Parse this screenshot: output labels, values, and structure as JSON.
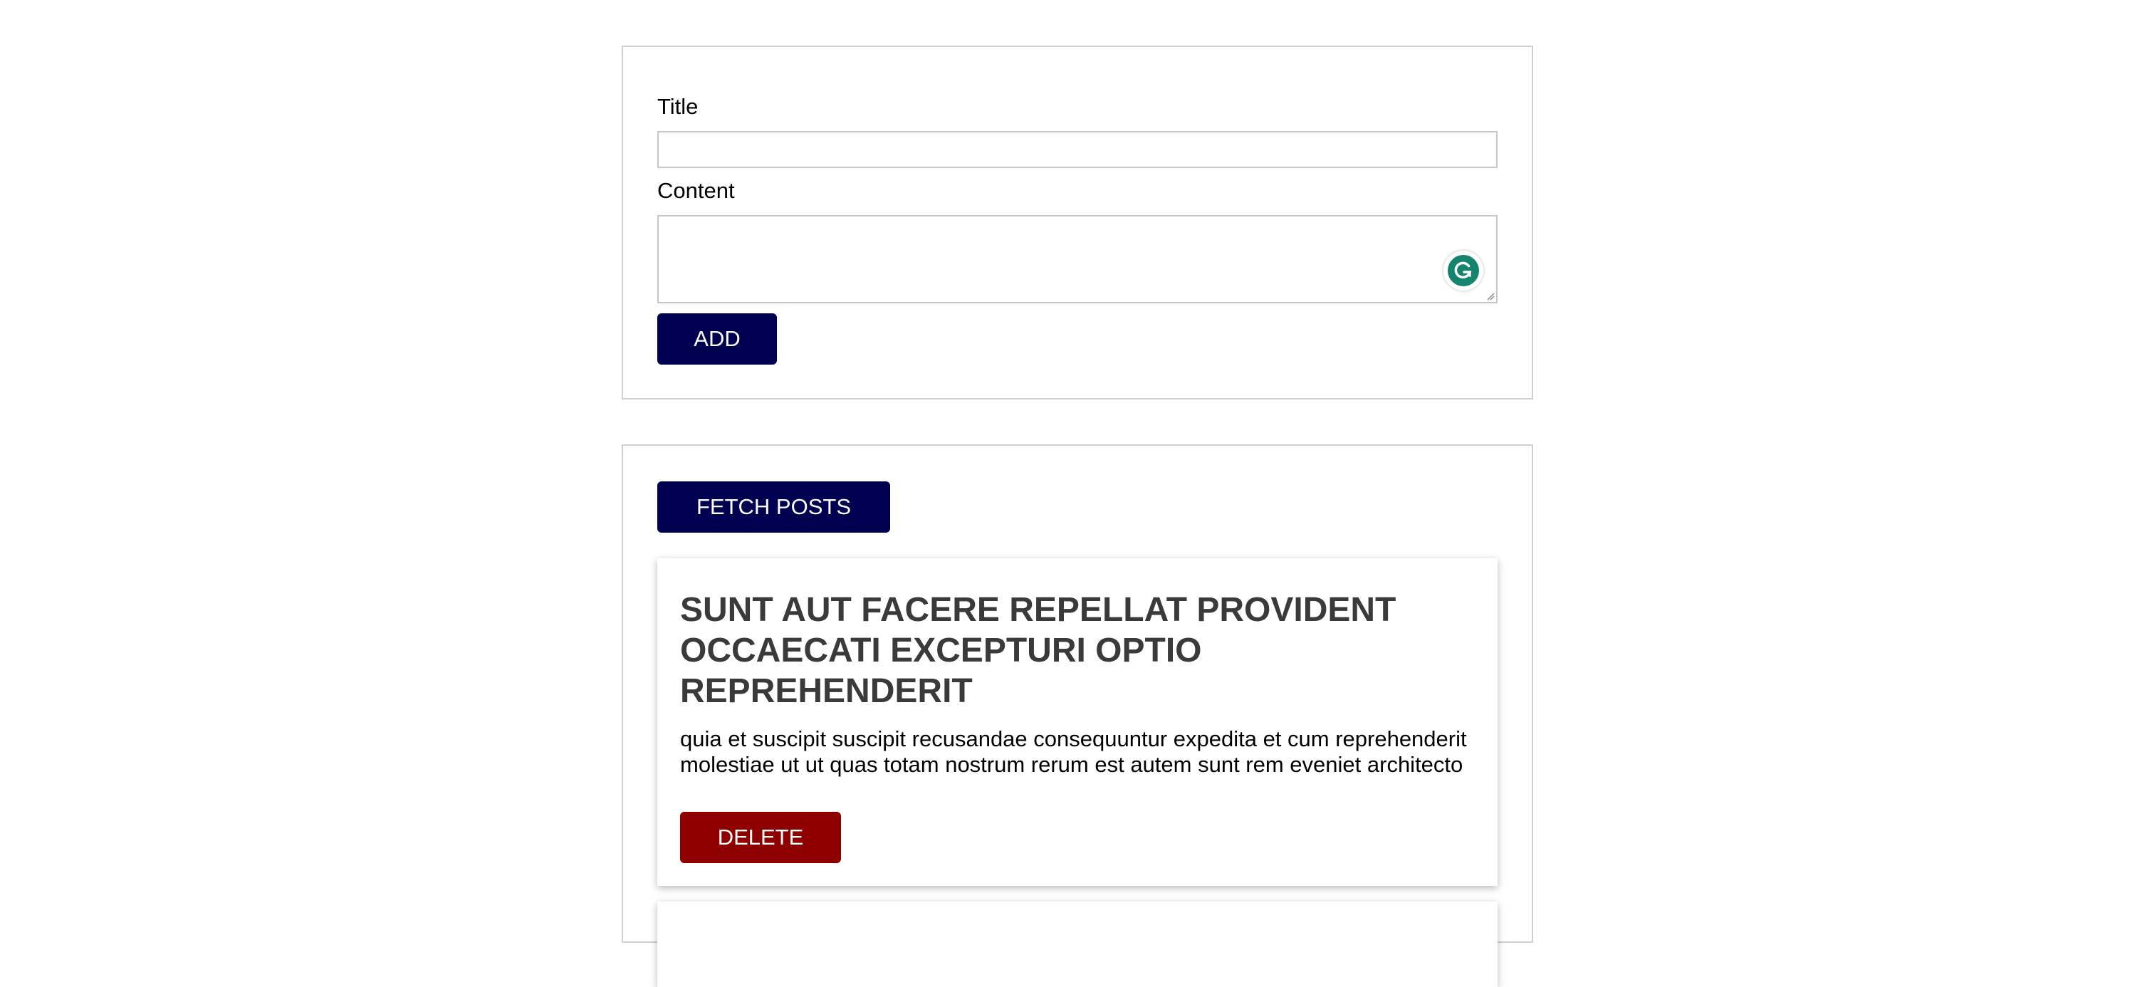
{
  "form": {
    "title_label": "Title",
    "title_value": "",
    "content_label": "Content",
    "content_value": "",
    "add_button": "ADD"
  },
  "posts_panel": {
    "fetch_button": "FETCH POSTS",
    "posts": [
      {
        "title": "sunt aut facere repellat provident occaecati excepturi optio reprehenderit",
        "body": "quia et suscipit suscipit recusandae consequuntur expedita et cum reprehenderit molestiae ut ut quas totam nostrum rerum est autem sunt rem eveniet architecto",
        "delete_button": "DELETE"
      }
    ]
  },
  "colors": {
    "primary_button": "#000050",
    "delete_button": "#8e0000",
    "grammarly": "#15846f"
  },
  "icons": {
    "grammarly": "grammarly-g-icon",
    "resize": "resize-grip-icon"
  }
}
